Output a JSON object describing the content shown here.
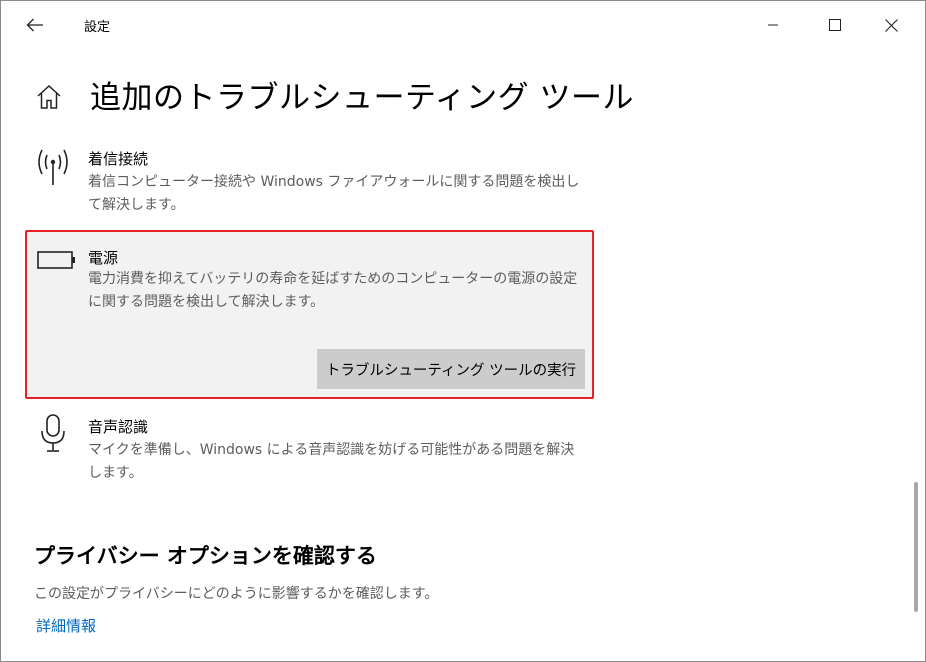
{
  "window": {
    "title": "設定",
    "back_icon": "arrow-left-icon",
    "minimize_icon": "minimize-icon",
    "maximize_icon": "maximize-icon",
    "close_icon": "close-icon"
  },
  "header": {
    "home_icon": "home-icon",
    "title": "追加のトラブルシューティング ツール"
  },
  "troubleshooters": [
    {
      "icon": "antenna-signal-icon",
      "title": "着信接続",
      "description": "着信コンピューター接続や Windows ファイアウォールに関する問題を検出して解決します。"
    },
    {
      "icon": "battery-icon",
      "title": "電源",
      "description": "電力消費を抑えてバッテリの寿命を延ばすためのコンピューターの電源の設定に関する問題を検出して解決します。",
      "selected": true,
      "run_button_label": "トラブルシューティング ツールの実行"
    },
    {
      "icon": "microphone-icon",
      "title": "音声認識",
      "description": "マイクを準備し、Windows による音声認識を妨げる可能性がある問題を解決します。"
    }
  ],
  "privacy": {
    "title": "プライバシー オプションを確認する",
    "description": "この設定がプライバシーにどのように影響するかを確認します。",
    "link_label": "詳細情報"
  },
  "colors": {
    "selection_border": "#e8202a",
    "selected_background": "#f2f2f2",
    "button_background": "#cccccc",
    "link": "#0067c0",
    "secondary_text": "#5d5d5d"
  }
}
